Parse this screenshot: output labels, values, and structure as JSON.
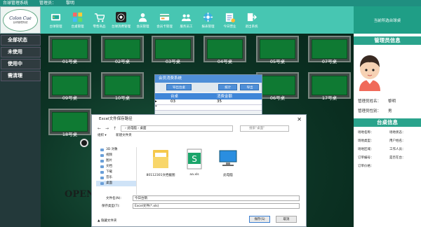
{
  "titlebar": {
    "app": "台球管理系统",
    "manager_label": "管理员：",
    "manager_name": "黎明"
  },
  "logo": {
    "text": "Colon Cue",
    "sub": "台球管理系统"
  },
  "toolbar": [
    {
      "label": "台球管理",
      "icon": "billiards-icon"
    },
    {
      "label": "台桌管理",
      "icon": "grid-icon"
    },
    {
      "label": "零售商品",
      "icon": "cart-icon"
    },
    {
      "label": "台球消费管理",
      "icon": "billiard-ball-icon"
    },
    {
      "label": "会员管理",
      "icon": "member-icon"
    },
    {
      "label": "会员卡管理",
      "icon": "card-icon"
    },
    {
      "label": "服务员工",
      "icon": "staff-icon"
    },
    {
      "label": "报表管理",
      "icon": "settings-icon"
    },
    {
      "label": "今日营业",
      "icon": "report-icon"
    },
    {
      "label": "退出系统",
      "icon": "exit-icon"
    }
  ],
  "sidebar": [
    {
      "label": "全部状态"
    },
    {
      "label": "未使用"
    },
    {
      "label": "使用中"
    },
    {
      "label": "需清理"
    }
  ],
  "tables": [
    "01号桌",
    "02号桌",
    "03号桌",
    "04号桌",
    "05号桌",
    "06号桌",
    "07号桌",
    "09号桌",
    "10号桌",
    "17号桌",
    "18号桌"
  ],
  "watermark": "OPEN D",
  "right_panel": {
    "header": "当前所选台球桌",
    "admin_title": "管理员信息",
    "name_label": "管理员姓名：",
    "name_value": "黎明",
    "gender_label": "管理员性别：",
    "gender_value": "男",
    "table_title": "台桌信息",
    "fields": [
      "场地名称：",
      "场地状态：",
      "场地类型：",
      "用户姓名：",
      "场地区域：",
      "工作人员：",
      "订单编号：",
      "是否在台：",
      "订单价格："
    ]
  },
  "consume_dialog": {
    "title": "会员消费系统",
    "buttons": [
      "导出台桌",
      "统计",
      "导出"
    ],
    "columns": [
      "台桌",
      "消费金额"
    ],
    "rows": [
      [
        "03",
        "35"
      ]
    ]
  },
  "file_dialog": {
    "title": "Excel文件保存路径",
    "close": "✕",
    "address": [
      "此电脑",
      "桌面"
    ],
    "search_placeholder": "搜索\"桌面\"",
    "organize": "组织 ▾",
    "new_folder": "新建文件夹",
    "tree": [
      "3D 对象",
      "视频",
      "图片",
      "文档",
      "下载",
      "音乐",
      "桌面"
    ],
    "files": [
      {
        "name": "80112301文档截图"
      },
      {
        "name": "aa.xls"
      },
      {
        "name": "此电脑"
      }
    ],
    "filename_label": "文件名(N):",
    "filename_value": "今日台销",
    "filetype_label": "保存类型(T):",
    "filetype_value": "Excel文件(*.xls)",
    "save": "保存(S)",
    "cancel": "取消",
    "hide": "▲ 隐藏文件夹"
  }
}
